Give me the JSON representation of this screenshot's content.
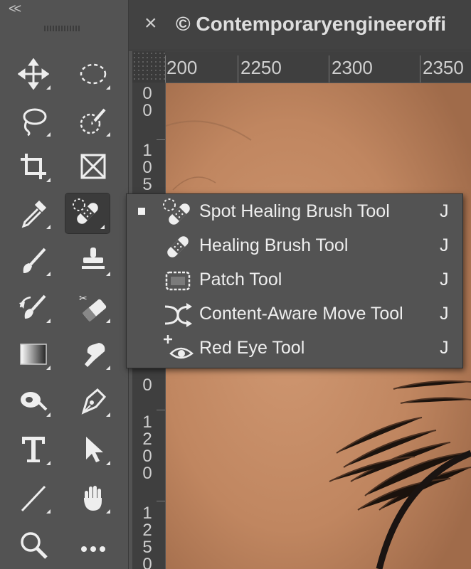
{
  "toolbar": {
    "collapse_glyph": "<<",
    "tools": [
      {
        "name": "move-tool",
        "icon": "move-icon",
        "has_flyout": true
      },
      {
        "name": "rectangular-marquee-tool",
        "icon": "marquee-ellipse-icon",
        "has_flyout": true
      },
      {
        "name": "lasso-tool",
        "icon": "lasso-icon",
        "has_flyout": true
      },
      {
        "name": "quick-selection-tool",
        "icon": "quick-selection-icon",
        "has_flyout": true
      },
      {
        "name": "crop-tool",
        "icon": "crop-icon",
        "has_flyout": true
      },
      {
        "name": "frame-tool",
        "icon": "frame-icon",
        "has_flyout": false
      },
      {
        "name": "eyedropper-tool",
        "icon": "eyedropper-icon",
        "has_flyout": true
      },
      {
        "name": "spot-healing-brush-tool",
        "icon": "bandage-icon",
        "has_flyout": true,
        "active": true
      },
      {
        "name": "brush-tool",
        "icon": "brush-icon",
        "has_flyout": true
      },
      {
        "name": "clone-stamp-tool",
        "icon": "stamp-icon",
        "has_flyout": true
      },
      {
        "name": "history-brush-tool",
        "icon": "history-brush-icon",
        "has_flyout": true
      },
      {
        "name": "eraser-tool",
        "icon": "eraser-icon",
        "has_flyout": true
      },
      {
        "name": "gradient-tool",
        "icon": "gradient-icon",
        "has_flyout": true
      },
      {
        "name": "smudge-tool",
        "icon": "smudge-icon",
        "has_flyout": true
      },
      {
        "name": "dodge-tool",
        "icon": "dodge-icon",
        "has_flyout": true
      },
      {
        "name": "pen-tool",
        "icon": "pen-icon",
        "has_flyout": true
      },
      {
        "name": "type-tool",
        "icon": "type-icon",
        "has_flyout": true
      },
      {
        "name": "path-selection-tool",
        "icon": "arrow-icon",
        "has_flyout": true
      },
      {
        "name": "line-tool",
        "icon": "line-icon",
        "has_flyout": true
      },
      {
        "name": "hand-tool",
        "icon": "hand-icon",
        "has_flyout": true
      },
      {
        "name": "zoom-tool",
        "icon": "zoom-icon",
        "has_flyout": false
      },
      {
        "name": "edit-toolbar",
        "icon": "more-icon",
        "has_flyout": false
      }
    ]
  },
  "document": {
    "close_glyph": "×",
    "tab_title": "© Contemporaryengineeroffi"
  },
  "rulers": {
    "horizontal_labels": [
      "200",
      "2250",
      "2300",
      "2350"
    ],
    "vertical_labels": [
      "0\n0",
      "1\n0\n5",
      "0",
      "1\n2\n0\n0",
      "1\n2\n5\n0"
    ]
  },
  "flyout": {
    "items": [
      {
        "label": "Spot Healing Brush Tool",
        "shortcut": "J",
        "icon": "spot-healing-icon",
        "selected": true
      },
      {
        "label": "Healing Brush Tool",
        "shortcut": "J",
        "icon": "healing-brush-icon",
        "selected": false
      },
      {
        "label": "Patch Tool",
        "shortcut": "J",
        "icon": "patch-icon",
        "selected": false
      },
      {
        "label": "Content-Aware Move Tool",
        "shortcut": "J",
        "icon": "content-aware-move-icon",
        "selected": false
      },
      {
        "label": "Red Eye Tool",
        "shortcut": "J",
        "icon": "red-eye-icon",
        "selected": false
      }
    ]
  },
  "colors": {
    "ui_background": "#535353",
    "ruler_background": "#3f3f3f",
    "text": "#eeeeee"
  }
}
